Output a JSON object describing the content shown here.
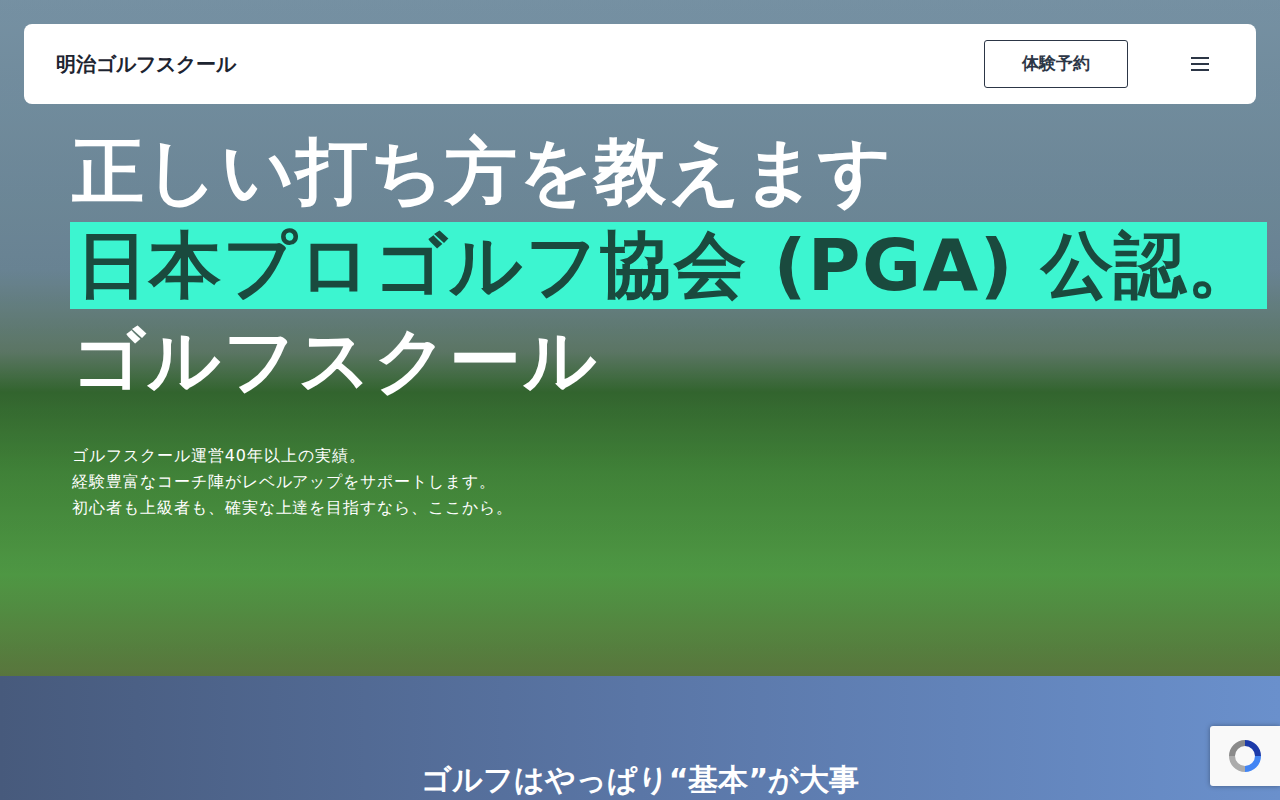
{
  "header": {
    "logo": "明治ゴルフスクール",
    "reserve_button": "体験予約"
  },
  "hero": {
    "headline": [
      {
        "text": "正しい打ち方を教えます",
        "highlighted": false
      },
      {
        "text": "日本プロゴルフ協会 (PGA) 公認。",
        "highlighted": true
      },
      {
        "text": "ゴルフスクール",
        "highlighted": false
      }
    ],
    "lead": [
      "ゴルフスクール運営40年以上の実績。",
      "経験豊富なコーチ陣がレベルアップをサポートします。",
      "初心者も上級者も、確実な上達を目指すなら、ここから。"
    ]
  },
  "section": {
    "title": "ゴルフはやっぱり“基本”が大事"
  }
}
